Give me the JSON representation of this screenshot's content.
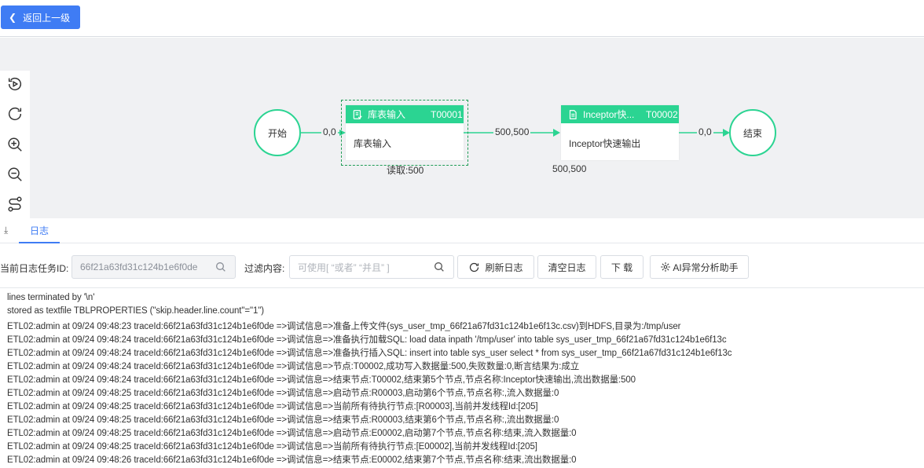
{
  "header": {
    "back_label": "返回上一级"
  },
  "canvas": {
    "start_label": "开始",
    "end_label": "结束",
    "task1": {
      "name": "库表输入",
      "code": "T00001",
      "body": "库表输入",
      "read_label": "读取:500"
    },
    "task2": {
      "name": "Inceptor快...",
      "code": "T00002",
      "body": "Inceptor快速输出",
      "count_label": "500,500"
    },
    "edges": {
      "e1": "0,0",
      "e2": "500,500",
      "e3": "0,0"
    }
  },
  "tabs": {
    "log_label": "日志"
  },
  "filters": {
    "task_id_label": "当前日志任务ID:",
    "task_id_value": "66f21a63fd31c124b1e6f0de",
    "filter_label": "过滤内容:",
    "filter_placeholder": "可使用[ “或者” “并且” ]",
    "refresh_label": "刷新日志",
    "clear_label": "清空日志",
    "download_label": "下 载",
    "ai_label": "AI异常分析助手"
  },
  "log_lines": [
    "lines terminated by '\\n'",
    "stored as textfile TBLPROPERTIES (\"skip.header.line.count\"=\"1\")",
    "ETL02:admin at 09/24 09:48:23 traceId:66f21a63fd31c124b1e6f0de =>调试信息=>准备上传文件(sys_user_tmp_66f21a67fd31c124b1e6f13c.csv)到HDFS,目录为:/tmp/user",
    "ETL02:admin at 09/24 09:48:24 traceId:66f21a63fd31c124b1e6f0de =>调试信息=>准备执行加载SQL: load data inpath '/tmp/user' into table sys_user_tmp_66f21a67fd31c124b1e6f13c",
    "ETL02:admin at 09/24 09:48:24 traceId:66f21a63fd31c124b1e6f0de =>调试信息=>准备执行插入SQL: insert into table sys_user select * from sys_user_tmp_66f21a67fd31c124b1e6f13c",
    "ETL02:admin at 09/24 09:48:24 traceId:66f21a63fd31c124b1e6f0de =>调试信息=>节点:T00002,成功写入数据量:500,失败数量:0,断言结果为:成立",
    "ETL02:admin at 09/24 09:48:24 traceId:66f21a63fd31c124b1e6f0de =>调试信息=>结束节点:T00002,结束第5个节点,节点名称:Inceptor快速输出,流出数据量:500",
    "ETL02:admin at 09/24 09:48:25 traceId:66f21a63fd31c124b1e6f0de =>调试信息=>启动节点:R00003,启动第6个节点,节点名称:,流入数据量:0",
    "ETL02:admin at 09/24 09:48:25 traceId:66f21a63fd31c124b1e6f0de =>调试信息=>当前所有待执行节点:[R00003],当前并发线程Id:[205]",
    "ETL02:admin at 09/24 09:48:25 traceId:66f21a63fd31c124b1e6f0de =>调试信息=>结束节点:R00003,结束第6个节点,节点名称:,流出数据量:0",
    "ETL02:admin at 09/24 09:48:25 traceId:66f21a63fd31c124b1e6f0de =>调试信息=>启动节点:E00002,启动第7个节点,节点名称:结束,流入数据量:0",
    "ETL02:admin at 09/24 09:48:25 traceId:66f21a63fd31c124b1e6f0de =>调试信息=>当前所有待执行节点:[E00002],当前并发线程Id:[205]",
    "ETL02:admin at 09/24 09:48:26 traceId:66f21a63fd31c124b1e6f0de =>调试信息=>结束节点:E00002,结束第7个节点,节点名称:结束,流出数据量:0"
  ],
  "colors": {
    "accent": "#3f7cf4",
    "node_green": "#2bd492",
    "canvas_bg": "#f0f1f3"
  }
}
